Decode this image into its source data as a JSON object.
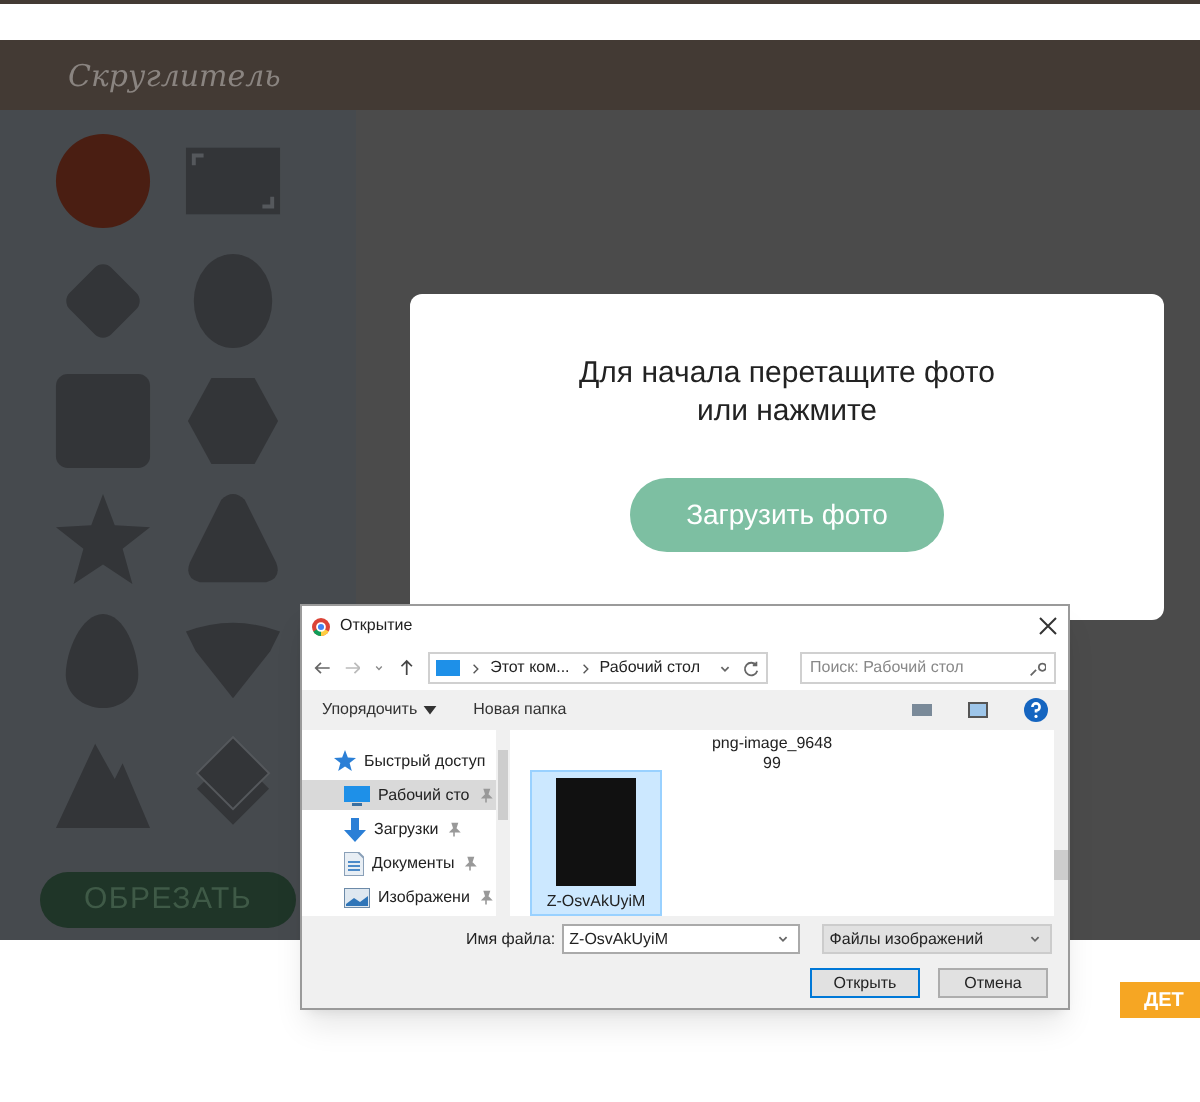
{
  "app_header": {
    "logo": "Скруглитель"
  },
  "shapes": [
    {
      "kind": "circle",
      "selected": true
    },
    {
      "kind": "frame",
      "selected": false
    },
    {
      "kind": "rhombus",
      "selected": false
    },
    {
      "kind": "oval",
      "selected": false
    },
    {
      "kind": "square",
      "selected": false
    },
    {
      "kind": "hexagon",
      "selected": false
    },
    {
      "kind": "star",
      "selected": false
    },
    {
      "kind": "triangle",
      "selected": false
    },
    {
      "kind": "egg",
      "selected": false
    },
    {
      "kind": "gem",
      "selected": false
    },
    {
      "kind": "mountains",
      "selected": false
    },
    {
      "kind": "layers",
      "selected": false
    }
  ],
  "crop_button": "ОБРЕЗАТЬ",
  "upload_card": {
    "prompt": "Для начала перетащите фото или нажмите",
    "button": "Загрузить фото"
  },
  "file_dialog": {
    "title": "Открытие",
    "breadcrumb": [
      "Этот ком...",
      "Рабочий стол"
    ],
    "search_placeholder": "Поиск: Рабочий стол",
    "toolbar": [
      "Упорядочить",
      "Новая папка"
    ],
    "nav": [
      {
        "label": "Быстрый доступ",
        "kind": "group",
        "selected": false
      },
      {
        "label": "Рабочий сто",
        "kind": "desktop",
        "selected": true
      },
      {
        "label": "Загрузки",
        "kind": "downloads",
        "selected": false
      },
      {
        "label": "Документы",
        "kind": "documents",
        "selected": false
      },
      {
        "label": "Изображени",
        "kind": "pictures",
        "selected": false
      }
    ],
    "files": [
      {
        "name": "png-image_964899",
        "kind": "label",
        "selected": false
      },
      {
        "name": "Z-OsvAkUyiM",
        "kind": "photo",
        "selected": true
      }
    ],
    "filename_label": "Имя файла:",
    "filename": "Z-OsvAkUyiM",
    "filetype": "Файлы изображений",
    "buttons": [
      "Открыть",
      "Отмена"
    ]
  },
  "badge": "ДЕТ"
}
